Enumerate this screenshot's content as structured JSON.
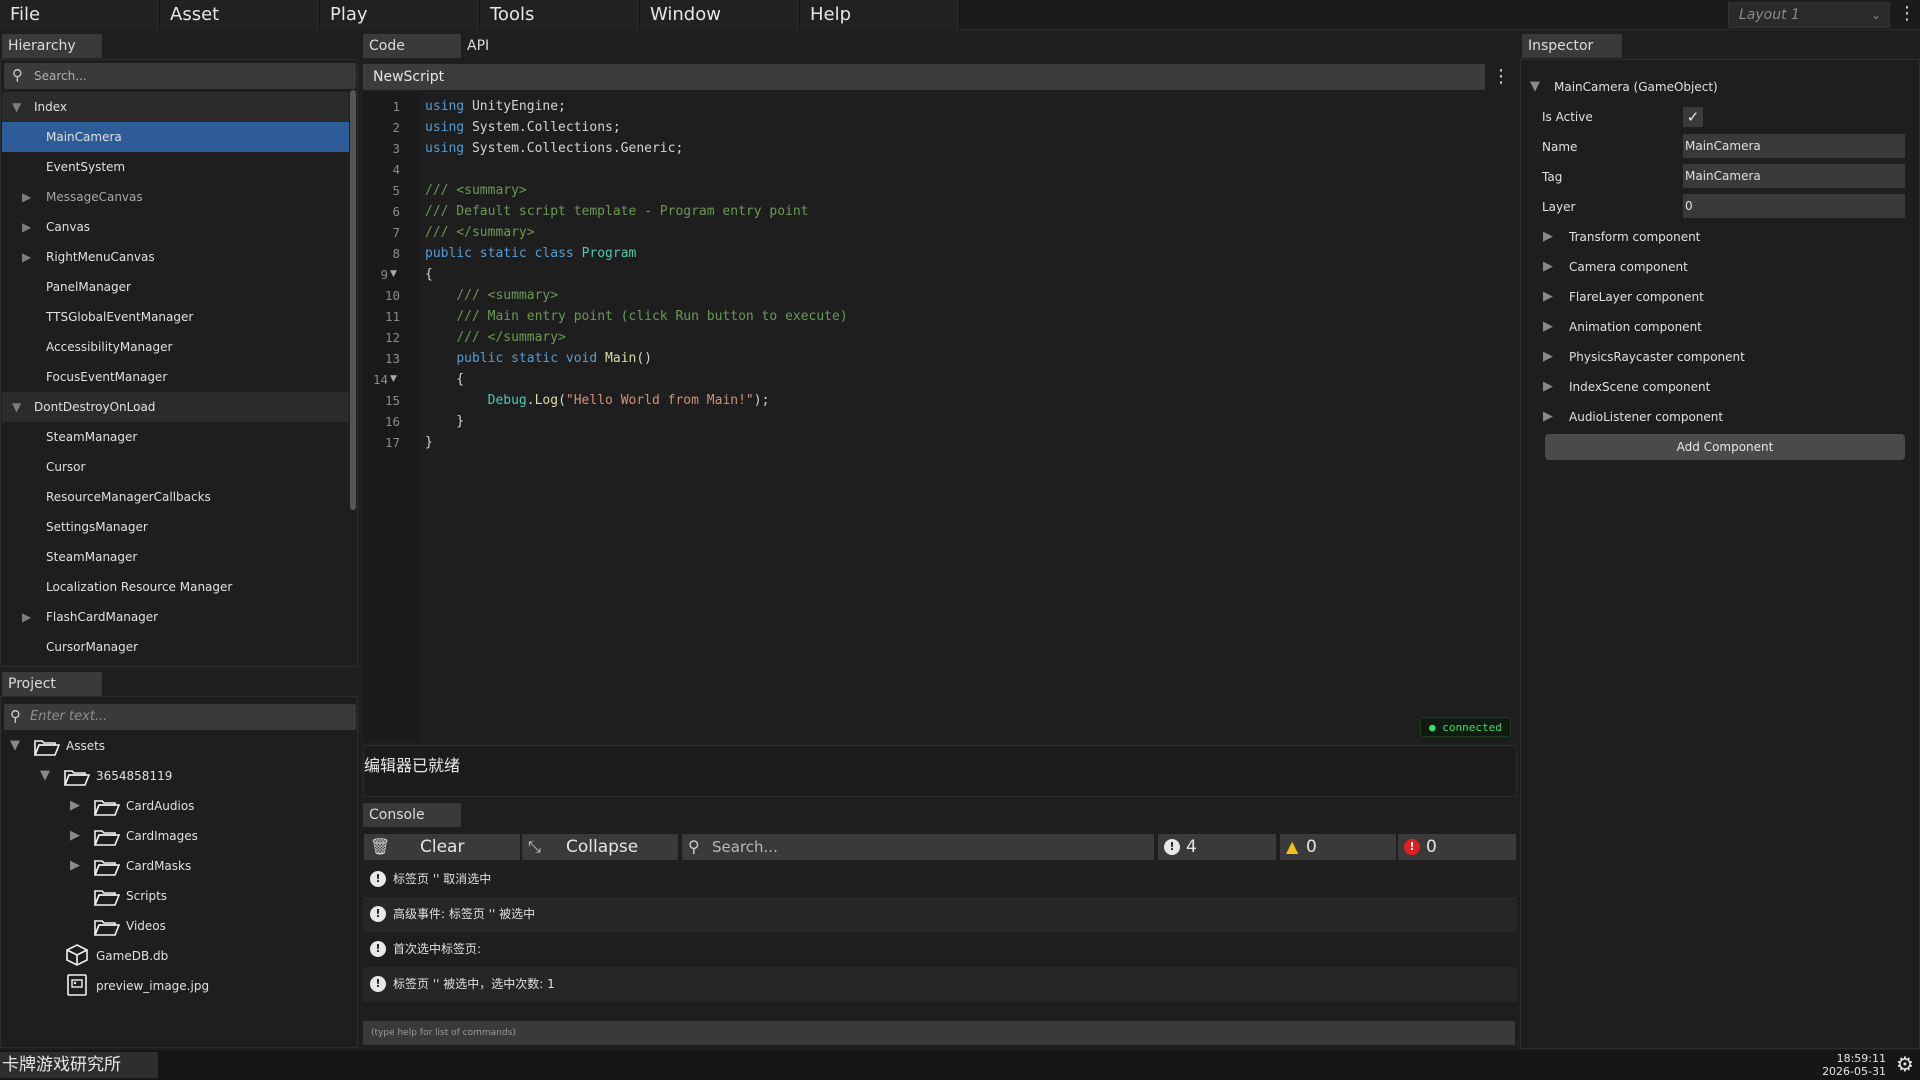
{
  "menu": {
    "items": [
      "File",
      "Asset",
      "Play",
      "Tools",
      "Window",
      "Help"
    ],
    "layout_value": "Layout 1"
  },
  "hierarchy": {
    "tab": "Hierarchy",
    "search_placeholder": "Search...",
    "items": [
      {
        "label": "Index",
        "kind": "section",
        "expanded": true
      },
      {
        "label": "MainCamera",
        "selected": true
      },
      {
        "label": "EventSystem"
      },
      {
        "label": "MessageCanvas",
        "has_children": true,
        "dim": true
      },
      {
        "label": "Canvas",
        "has_children": true
      },
      {
        "label": "RightMenuCanvas",
        "has_children": true
      },
      {
        "label": "PanelManager"
      },
      {
        "label": "TTSGlobalEventManager"
      },
      {
        "label": "AccessibilityManager"
      },
      {
        "label": "FocusEventManager"
      },
      {
        "label": "DontDestroyOnLoad",
        "kind": "section",
        "expanded": true
      },
      {
        "label": "SteamManager"
      },
      {
        "label": "Cursor"
      },
      {
        "label": "ResourceManagerCallbacks"
      },
      {
        "label": "SettingsManager"
      },
      {
        "label": "SteamManager"
      },
      {
        "label": "Localization Resource Manager"
      },
      {
        "label": "FlashCardManager",
        "has_children": true
      },
      {
        "label": "CursorManager"
      }
    ]
  },
  "project": {
    "tab": "Project",
    "search_placeholder": "Enter text...",
    "items": [
      {
        "label": "Assets",
        "icon": "folder-open-icon",
        "arrow": "down"
      },
      {
        "label": "3654858119",
        "icon": "folder-open-icon",
        "arrow": "down"
      },
      {
        "label": "CardAudios",
        "icon": "folder-open-icon",
        "arrow": "right"
      },
      {
        "label": "CardImages",
        "icon": "folder-open-icon",
        "arrow": "right"
      },
      {
        "label": "CardMasks",
        "icon": "folder-open-icon",
        "arrow": "right"
      },
      {
        "label": "Scripts",
        "icon": "folder-open-icon",
        "arrow": ""
      },
      {
        "label": "Videos",
        "icon": "folder-open-icon",
        "arrow": ""
      },
      {
        "label": "GameDB.db",
        "icon": "cube-icon",
        "arrow": ""
      },
      {
        "label": "preview_image.jpg",
        "icon": "image-file-icon",
        "arrow": ""
      }
    ]
  },
  "editor": {
    "tabs": [
      "Code",
      "API"
    ],
    "script_name": "NewScript",
    "status_badge": "● connected",
    "status_text": "编辑器已就绪",
    "line_numbers": [
      "1",
      "2",
      "3",
      "4",
      "5",
      "6",
      "7",
      "8",
      "9",
      "10",
      "11",
      "12",
      "13",
      "14",
      "15",
      "16",
      "17"
    ],
    "fold_markers": {
      "9": "▼",
      "14": "▼"
    }
  },
  "console": {
    "tab": "Console",
    "clear_label": "Clear",
    "collapse_label": "Collapse",
    "search_placeholder": "Search...",
    "info_count": "4",
    "warn_count": "0",
    "error_count": "0",
    "messages": [
      "标签页 '' 取消选中",
      "高级事件: 标签页 '' 被选中",
      "首次选中标签页:",
      "标签页 '' 被选中，选中次数: 1"
    ],
    "command_placeholder": "(type help for list of commands)"
  },
  "inspector": {
    "tab": "Inspector",
    "object_title": "MainCamera (GameObject)",
    "is_active_label": "Is Active",
    "is_active": true,
    "name_label": "Name",
    "name_value": "MainCamera",
    "tag_label": "Tag",
    "tag_value": "MainCamera",
    "layer_label": "Layer",
    "layer_value": "0",
    "components": [
      "Transform component",
      "Camera component",
      "FlareLayer component",
      "Animation component",
      "PhysicsRaycaster component",
      "IndexScene component",
      "AudioListener component"
    ],
    "add_component_label": "Add Component"
  },
  "statusbar": {
    "studio_name": "卡牌游戏研究所",
    "time": "18:59:11",
    "date": "2026-05-31"
  },
  "colors": {
    "selection": "#2d5c98",
    "connected": "#3ddc6a",
    "keyword": "#569cd6",
    "comment": "#6a9955",
    "type": "#4ec9b0",
    "method": "#dcdcaa",
    "string": "#ce9178"
  }
}
